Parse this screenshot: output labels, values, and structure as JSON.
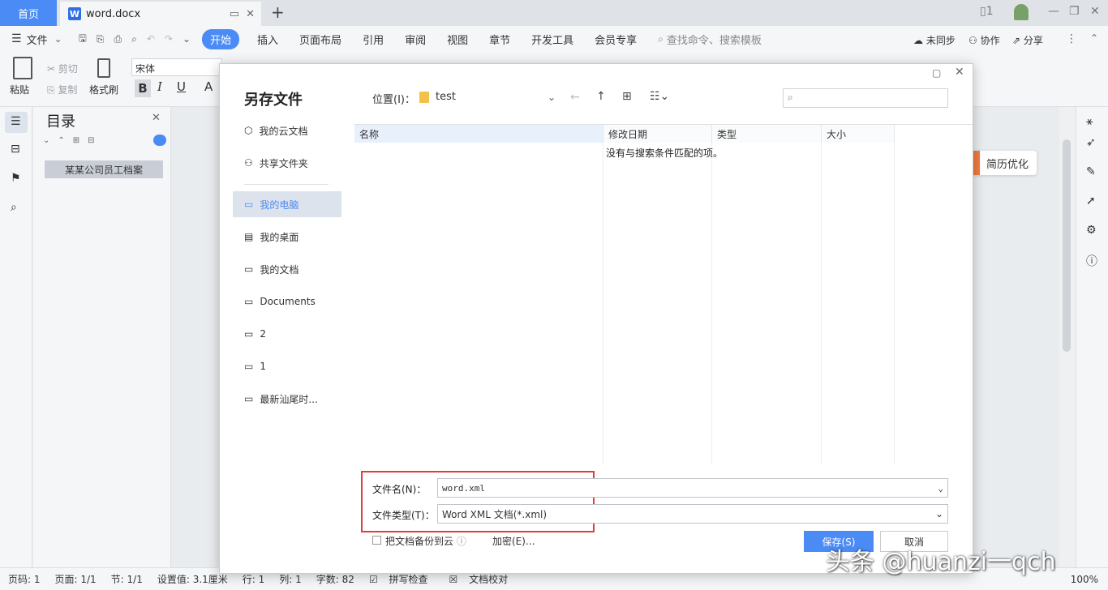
{
  "tabs": {
    "home": "首页",
    "document": "word.docx"
  },
  "menu": {
    "file": "文件",
    "items": [
      "开始",
      "插入",
      "页面布局",
      "引用",
      "审阅",
      "视图",
      "章节",
      "开发工具",
      "会员专享"
    ],
    "search": "查找命令、搜索模板",
    "sync": "未同步",
    "collab": "协作",
    "share": "分享"
  },
  "ribbon": {
    "paste": "粘贴",
    "cut": "剪切",
    "copy": "复制",
    "format_painter": "格式刷",
    "font": "宋体",
    "bold": "B",
    "italic": "I",
    "underline": "U"
  },
  "nav": {
    "title": "目录",
    "item": "某某公司员工档案"
  },
  "resume": "简历优化",
  "dialog": {
    "title": "另存文件",
    "sidebar": [
      "我的云文档",
      "共享文件夹",
      "我的电脑",
      "我的桌面",
      "我的文档",
      "Documents",
      "2",
      "1",
      "最新汕尾时..."
    ],
    "location_label": "位置(I)：",
    "location_value": "test",
    "columns": [
      "名称",
      "修改日期",
      "类型",
      "大小"
    ],
    "empty_message": "没有与搜索条件匹配的项。",
    "filename_label": "文件名(N)：",
    "filename_value": "word.xml",
    "filetype_label": "文件类型(T)：",
    "filetype_value": "Word XML 文档(*.xml)",
    "cloud_backup": "把文档备份到云",
    "encrypt": "加密(E)...",
    "save": "保存(S)",
    "cancel": "取消"
  },
  "status": {
    "page": "页码: 1",
    "pages": "页面: 1/1",
    "section": "节: 1/1",
    "setting": "设置值: 3.1厘米",
    "row": "行: 1",
    "col": "列: 1",
    "words": "字数: 82",
    "spell": "拼写检查",
    "proof": "文档校对",
    "zoom": "100%"
  },
  "watermark": "头条 @huanzi一qch",
  "colors": {
    "accent": "#4a8bf5",
    "highlight": "#e23c3c",
    "resume_bar": "#f07b3f"
  }
}
